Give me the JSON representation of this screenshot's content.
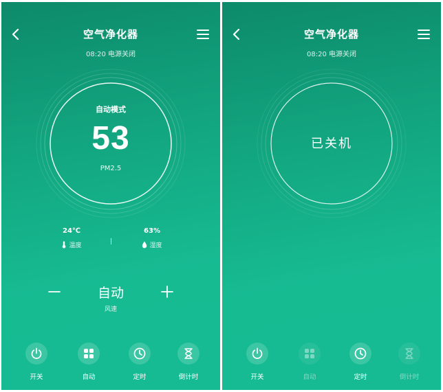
{
  "left_screen": {
    "title": "空气净化器",
    "subtitle": "08:20 电源关闭",
    "mode": "自动模式",
    "pm_value": "53",
    "pm_label": "PM2.5",
    "temperature": {
      "value": "24℃",
      "label": "温度"
    },
    "humidity": {
      "value": "63%",
      "label": "湿度"
    },
    "fan_speed": {
      "value": "自动",
      "label": "风速"
    },
    "controls": [
      {
        "label": "开关",
        "icon": "power-icon"
      },
      {
        "label": "自动",
        "icon": "grid-icon"
      },
      {
        "label": "定时",
        "icon": "clock-icon"
      },
      {
        "label": "倒计时",
        "icon": "hourglass-icon"
      }
    ]
  },
  "right_screen": {
    "title": "空气净化器",
    "subtitle": "08:20 电源关闭",
    "status": "已关机",
    "controls": [
      {
        "label": "开关",
        "icon": "power-icon",
        "enabled": true
      },
      {
        "label": "自动",
        "icon": "grid-icon",
        "enabled": false
      },
      {
        "label": "定时",
        "icon": "clock-icon",
        "enabled": true
      },
      {
        "label": "倒计时",
        "icon": "hourglass-icon",
        "enabled": false
      }
    ]
  },
  "colors": {
    "gradient_top": "#0d8a6a",
    "gradient_bottom": "#16bb94",
    "text": "#ffffff"
  }
}
